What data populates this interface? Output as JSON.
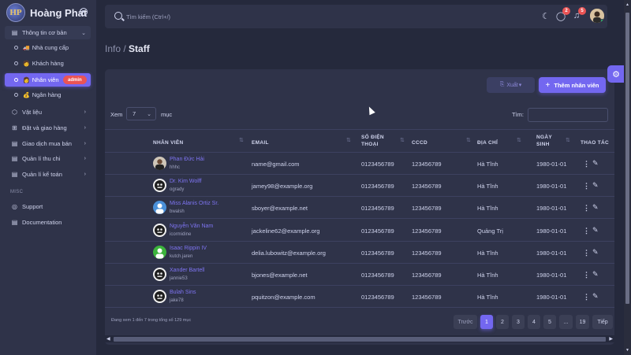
{
  "brand": {
    "name": "Hoàng Phát",
    "logo_text": "HP"
  },
  "sidebar": {
    "items": [
      {
        "label": "Thông tin cơ bản",
        "icon": "document-icon",
        "open": true
      },
      {
        "label": "Vật liệu",
        "icon": "cube-icon"
      },
      {
        "label": "Đặt và giao hàng",
        "icon": "cart-icon"
      },
      {
        "label": "Giao dịch mua bán",
        "icon": "document-icon"
      },
      {
        "label": "Quản lí thu chi",
        "icon": "document-icon"
      },
      {
        "label": "Quản lí kế toán",
        "icon": "document-icon"
      }
    ],
    "sub_items": [
      {
        "label": "Nhà cung cấp",
        "emoji": "🚚"
      },
      {
        "label": "Khách hàng",
        "emoji": "🧑"
      },
      {
        "label": "Nhân viên",
        "emoji": "👩",
        "active": true,
        "badge": "admin"
      },
      {
        "label": "Ngân hàng",
        "emoji": "💰"
      }
    ],
    "section_label": "MISC",
    "misc": [
      {
        "label": "Support",
        "icon": "lifebuoy-icon"
      },
      {
        "label": "Documentation",
        "icon": "document-icon"
      }
    ]
  },
  "topbar": {
    "search_placeholder": "Tìm kiếm (Ctrl+/)",
    "chat_count": "2",
    "notif_count": "5"
  },
  "breadcrumb": {
    "parent": "Info",
    "separator": " / ",
    "current": "Staff"
  },
  "toolbar": {
    "export_label": "Xuất",
    "add_label": "Thêm nhân viên"
  },
  "table_controls": {
    "show_label": "Xem",
    "page_length": "7",
    "entries_label": "mục",
    "filter_label": "Tìm:"
  },
  "table": {
    "headers": {
      "staff": "NHÂN VIÊN",
      "email": "EMAIL",
      "phone_1": "SỐ ĐIỆN",
      "phone_2": "THOẠI",
      "id": "CCCD",
      "address": "ĐỊA CHỈ",
      "dob_1": "NGÀY",
      "dob_2": "SINH",
      "actions": "THAO TÁC"
    },
    "rows": [
      {
        "name": "Phan Đức Hải",
        "login": "hhhc",
        "email": "name@gmail.com",
        "phone": "0123456789",
        "cccd": "123456789",
        "address": "Hà Tĩnh",
        "dob": "1980-01-01",
        "avatar": "photo"
      },
      {
        "name": "Dr. Kim Wolff",
        "login": "ogrady",
        "email": "jamey98@example.org",
        "phone": "0123456789",
        "cccd": "123456789",
        "address": "Hà Tĩnh",
        "dob": "1980-01-01",
        "avatar": "dark"
      },
      {
        "name": "Miss Alanis Ortiz Sr.",
        "login": "bwalsh",
        "email": "sboyer@example.net",
        "phone": "0123456789",
        "cccd": "123456789",
        "address": "Hà Tĩnh",
        "dob": "1980-01-01",
        "avatar": "blue"
      },
      {
        "name": "Nguyễn Văn Nam",
        "login": "icormidine",
        "email": "jackeline62@example.org",
        "phone": "0123456789",
        "cccd": "123456789",
        "address": "Quảng Trị",
        "dob": "1980-01-01",
        "avatar": "dark"
      },
      {
        "name": "Isaac Rippin IV",
        "login": "kutch.jaren",
        "email": "delia.lubowitz@example.org",
        "phone": "0123456789",
        "cccd": "123456789",
        "address": "Hà Tĩnh",
        "dob": "1980-01-01",
        "avatar": "green"
      },
      {
        "name": "Xander Bartell",
        "login": "jannie53",
        "email": "bjones@example.net",
        "phone": "0123456789",
        "cccd": "123456789",
        "address": "Hà Tĩnh",
        "dob": "1980-01-01",
        "avatar": "dark"
      },
      {
        "name": "Bulah Sins",
        "login": "jake78",
        "email": "pquitzon@example.com",
        "phone": "0123456789",
        "cccd": "123456789",
        "address": "Hà Tĩnh",
        "dob": "1980-01-01",
        "avatar": "dark"
      }
    ]
  },
  "pagination": {
    "info": "Đang xem 1 đến 7 trong tổng số 129 mục",
    "prev": "Trước",
    "pages": [
      "1",
      "2",
      "3",
      "4",
      "5",
      "...",
      "19"
    ],
    "next": "Tiếp",
    "current": "1"
  },
  "colors": {
    "primary": "#7367f0",
    "danger": "#ea5455",
    "success": "#28c76f",
    "background": "#25293c",
    "card": "#2f3349"
  }
}
